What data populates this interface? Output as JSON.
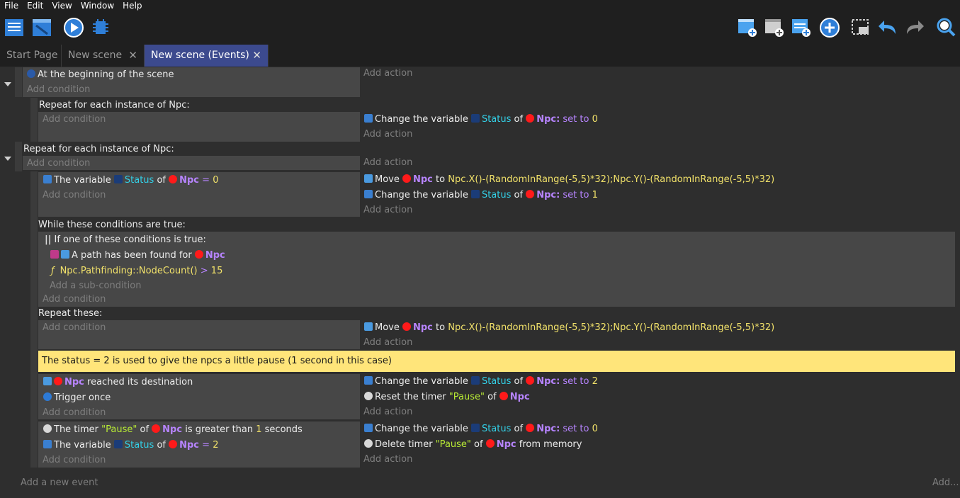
{
  "menu": [
    "File",
    "Edit",
    "View",
    "Window",
    "Help"
  ],
  "toolbar": {
    "left": [
      "project-manager-icon",
      "scene-editor-icon",
      "preview-icon",
      "debugger-icon"
    ],
    "right": [
      "add-event-icon",
      "add-subevent-icon",
      "add-other-icon",
      "add-group-icon",
      "delete-icon",
      "undo-icon",
      "redo-icon",
      "search-icon"
    ]
  },
  "tabs": [
    {
      "label": "Start Page"
    },
    {
      "label": "New scene",
      "close": "✕"
    },
    {
      "label": "New scene (Events)",
      "close": "✕"
    }
  ],
  "placeholders": {
    "add_action": "Add action",
    "add_condition": "Add condition",
    "add_subcondition": "Add a sub-condition",
    "add_event": "Add a new event",
    "add_more": "Add..."
  },
  "events": {
    "e1_cond": "At the beginning of the scene",
    "e2_header": "Repeat for each instance of Npc:",
    "e2_action": {
      "pre": "Change the variable ",
      "var": "Status",
      "of": " of ",
      "obj": "Npc:",
      "set": " set to ",
      "val": "0"
    },
    "e3_header": "Repeat for each instance of Npc:",
    "e4_cond": {
      "pre": "The variable ",
      "var": "Status",
      "of": " of ",
      "obj": "Npc",
      "op": " = ",
      "val": "0"
    },
    "e4_act1": {
      "pre": "Move ",
      "obj": "Npc",
      "to": " to ",
      "expr": "Npc.X()-(RandomInRange(-5,5)*32);Npc.Y()-(RandomInRange(-5,5)*32)"
    },
    "e4_act2": {
      "pre": "Change the variable ",
      "var": "Status",
      "of": " of ",
      "obj": "Npc:",
      "set": " set to ",
      "val": "1"
    },
    "while_header": "While these conditions are true:",
    "or_header": "If one of these conditions is true:",
    "path_cond": {
      "pre": "A path has been found for ",
      "obj": "Npc"
    },
    "node_cond": {
      "expr": "Npc.Pathfinding::NodeCount()",
      "op": " > ",
      "val": "15"
    },
    "repeat_header": "Repeat these:",
    "repeat_act": {
      "pre": "Move ",
      "obj": "Npc",
      "to": " to ",
      "expr": "Npc.X()-(RandomInRange(-5,5)*32);Npc.Y()-(RandomInRange(-5,5)*32)"
    },
    "comment": "The status = 2 is used to give the npcs a little pause (1 second in this case)",
    "e6_cond1": {
      "obj": "Npc",
      "post": " reached its destination"
    },
    "e6_cond2": "Trigger once",
    "e6_act1": {
      "pre": "Change the variable ",
      "var": "Status",
      "of": " of ",
      "obj": "Npc:",
      "set": " set to ",
      "val": "2"
    },
    "e6_act2": {
      "pre": "Reset the timer ",
      "str": "\"Pause\"",
      "of": " of ",
      "obj": "Npc"
    },
    "e7_cond1": {
      "pre": "The timer ",
      "str": "\"Pause\"",
      "of": " of ",
      "obj": "Npc",
      "mid": " is greater than ",
      "val": "1",
      "post": " seconds"
    },
    "e7_cond2": {
      "pre": "The variable ",
      "var": "Status",
      "of": " of ",
      "obj": "Npc",
      "op": " = ",
      "val": "2"
    },
    "e7_act1": {
      "pre": "Change the variable ",
      "var": "Status",
      "of": " of ",
      "obj": "Npc:",
      "set": " set to ",
      "val": "0"
    },
    "e7_act2": {
      "pre": "Delete timer ",
      "str": "\"Pause\"",
      "of": " of ",
      "obj": "Npc",
      "post": " from memory"
    }
  },
  "colors": {
    "accent_tab": "#3c4a8e",
    "comment_bg": "#ffe57a",
    "object": "#b784ff",
    "variable": "#33d1e8",
    "number": "#f2e26a",
    "string": "#b9ec35"
  }
}
